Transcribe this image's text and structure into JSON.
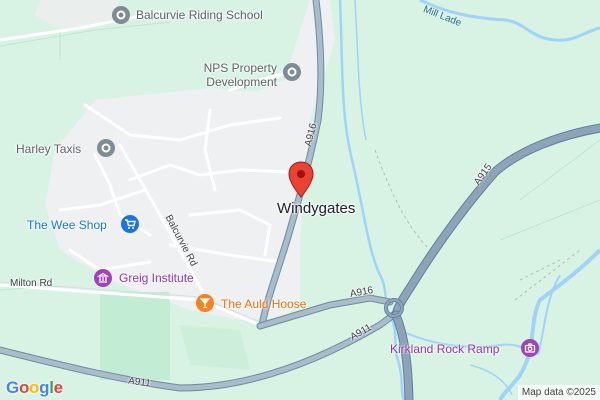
{
  "map": {
    "place": "Windygates",
    "pois": [
      {
        "label": "Balcurvie Riding School",
        "icon": "place-icon"
      },
      {
        "label": "NPS Property Development",
        "icon": "place-icon"
      },
      {
        "label": "Harley Taxis",
        "icon": "place-icon"
      },
      {
        "label": "The Wee Shop",
        "icon": "shopping-cart-icon"
      },
      {
        "label": "Greig Institute",
        "icon": "landmark-icon"
      },
      {
        "label": "The Auld Hoose",
        "icon": "bar-icon"
      },
      {
        "label": "Kirkland Rock Ramp",
        "icon": "camera-icon"
      }
    ],
    "roads": {
      "a916_north": "A916",
      "a916_south": "A916",
      "a915": "A915",
      "a911_east": "A911",
      "a911_west": "A911",
      "milton_rd": "Milton Rd",
      "balcurvie_rd": "Balcurvie Rd"
    },
    "water": {
      "mill_lade": "Mill Lade"
    },
    "logo": [
      "G",
      "o",
      "o",
      "g",
      "l",
      "e"
    ],
    "attribution": "Map data ©2025",
    "colors": {
      "land": "#d8f3e4",
      "built": "#eef0f2",
      "field": "#c3ecd4",
      "water": "#9fd4f7",
      "trunk_road": "#8da4b8",
      "minor_road": "#ffffff",
      "pin": "#ea4335",
      "poi_grey": "#7d8c96",
      "poi_blue": "#1a73e8",
      "poi_purple": "#a142b8",
      "poi_orange": "#f5821f"
    }
  }
}
